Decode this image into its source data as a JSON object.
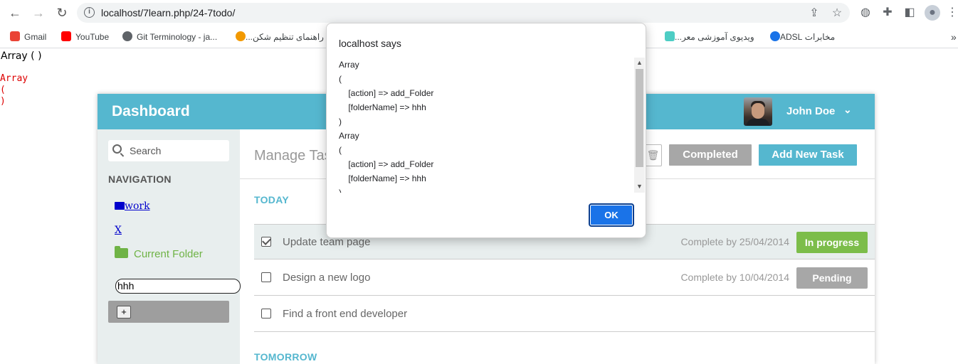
{
  "browser": {
    "url": "localhost/7learn.php/24-7todo/",
    "bookmarks": [
      {
        "label": "Gmail",
        "color": "#ea4335"
      },
      {
        "label": "YouTube",
        "color": "#ff0000"
      },
      {
        "label": "Git Terminology - ja...",
        "color": "#5f6368"
      },
      {
        "label": "راهنمای تنظیم شکن...",
        "color": "#f29900"
      },
      {
        "label": "ویدیوی آموزشی معر...",
        "color": "#4ecdc4"
      },
      {
        "label": "مخابرات ADSL",
        "color": "#1a73e8"
      }
    ],
    "more": "»"
  },
  "raw_output": {
    "line1": "Array ( )",
    "lines": [
      "Array",
      "(",
      ")"
    ]
  },
  "dashboard": {
    "title": "Dashboard",
    "user_name": "John Doe",
    "search_placeholder": "Search",
    "nav_label": "NAVIGATION",
    "folders": {
      "work": "work",
      "x": "X",
      "current": "Current Folder"
    },
    "folder_input_value": "hhh",
    "add_button": "+",
    "main_title": "Manage Tas",
    "completed_button": "Completed",
    "add_task_button": "Add New Task",
    "sections": {
      "today": "TODAY",
      "tomorrow": "TOMORROW"
    },
    "tasks": [
      {
        "name": "Update team page",
        "due": "Complete by 25/04/2014",
        "status": "In progress",
        "status_color": "#7cbd4a",
        "checked": true
      },
      {
        "name": "Design a new logo",
        "due": "Complete by 10/04/2014",
        "status": "Pending",
        "status_color": "#a7a7a7",
        "checked": false
      },
      {
        "name": "Find a front end developer",
        "due": "",
        "status": "",
        "checked": false
      }
    ]
  },
  "alert": {
    "title": "localhost says",
    "lines": [
      "Array",
      "(",
      "    [action] => add_Folder",
      "    [folderName] => hhh",
      ")",
      "Array",
      "(",
      "    [action] => add_Folder",
      "    [folderName] => hhh",
      ")"
    ],
    "ok_label": "OK"
  },
  "colors": {
    "accent": "#55b7cf",
    "green": "#6fb346"
  }
}
